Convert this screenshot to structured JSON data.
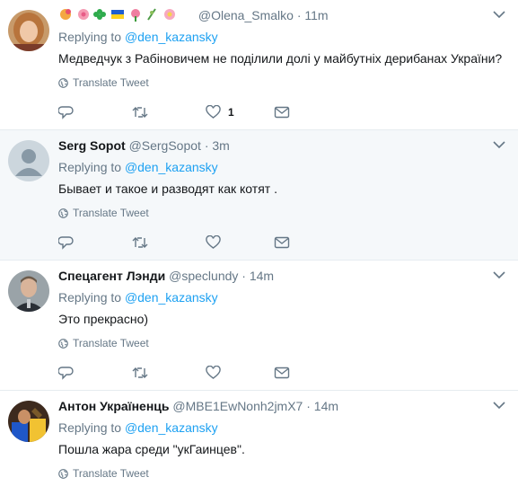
{
  "reply_prefix": "Replying to",
  "translate_label": "Translate Tweet",
  "colors": {
    "link": "#1da1f2",
    "muted": "#657786",
    "divider": "#e6ecf0",
    "highlight_bg": "#f5f8fa"
  },
  "icons": [
    "caret-down-icon",
    "globe-icon",
    "reply-icon",
    "retweet-icon",
    "like-icon",
    "message-icon",
    "emoji-icons"
  ],
  "tweets": [
    {
      "name": "",
      "handle": "@Olena_Smalko",
      "time": "11m",
      "reply_to": "@den_kazansky",
      "text": "Медведчук з Рабіновичем не поділили долі у майбутніх дерибанах України?",
      "likes": "1"
    },
    {
      "name": "Serg Sopot",
      "handle": "@SergSopot",
      "time": "3m",
      "reply_to": "@den_kazansky",
      "text": "Бывает и такое и разводят как  котят .",
      "likes": ""
    },
    {
      "name": "Спецагент Лэнди",
      "handle": "@speclundy",
      "time": "14m",
      "reply_to": "@den_kazansky",
      "text": "Это прекрасно)",
      "likes": ""
    },
    {
      "name": "Антон Україненць",
      "handle": "@MBE1EwNonh2jmX7",
      "time": "14m",
      "reply_to": "@den_kazansky",
      "text": "Пошла жара среди \"укГаинцев\".",
      "likes": ""
    }
  ]
}
